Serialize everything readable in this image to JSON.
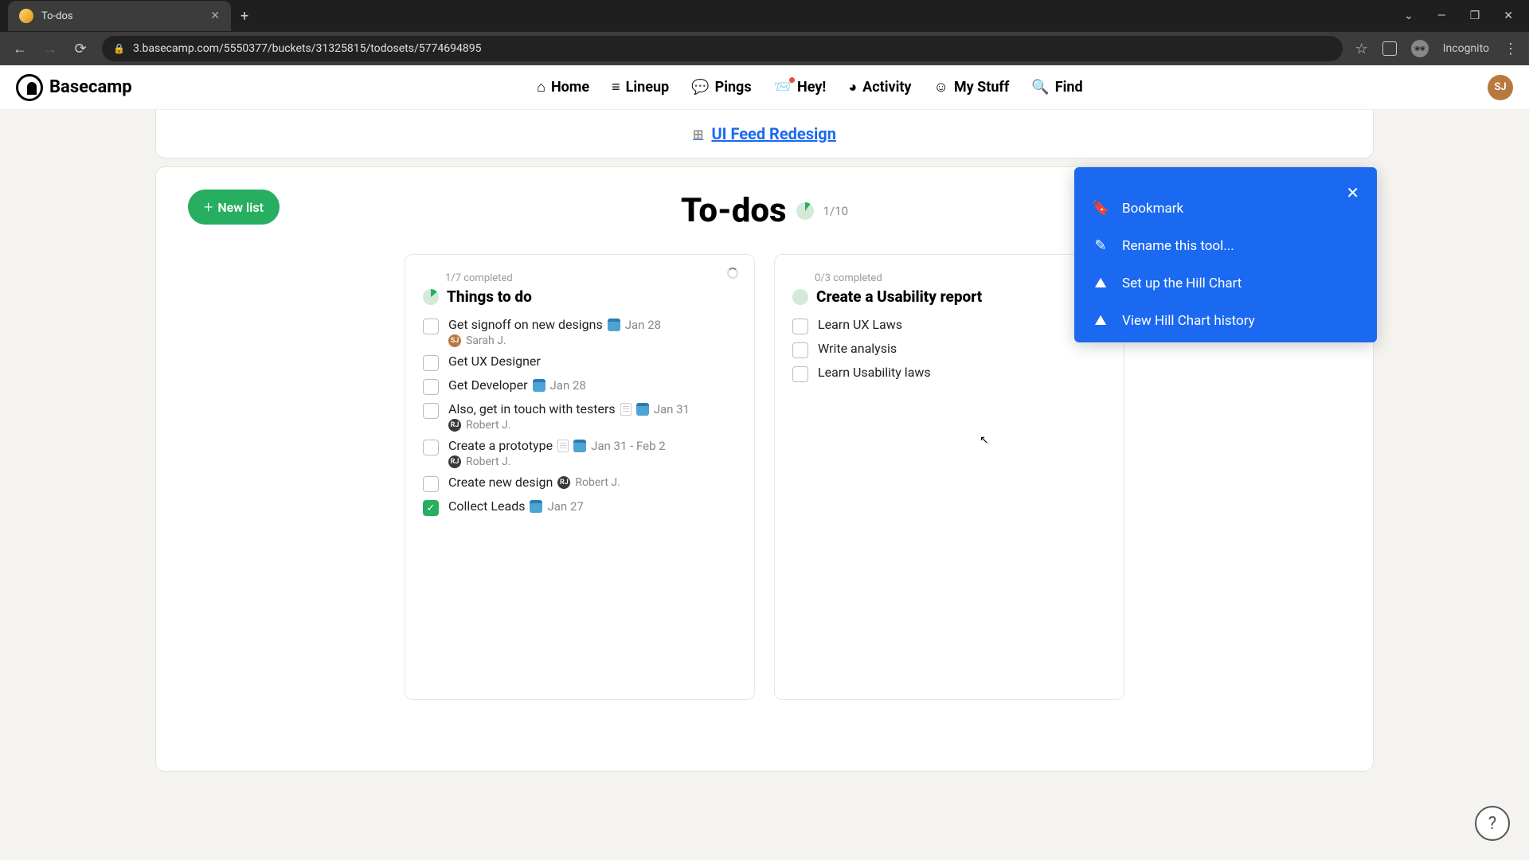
{
  "browser": {
    "tab_title": "To-dos",
    "url": "3.basecamp.com/5550377/buckets/31325815/todosets/5774694895",
    "incognito_label": "Incognito"
  },
  "nav": {
    "logo": "Basecamp",
    "items": {
      "home": "Home",
      "lineup": "Lineup",
      "pings": "Pings",
      "hey": "Hey!",
      "activity": "Activity",
      "mystuff": "My Stuff",
      "find": "Find"
    },
    "avatar_initials": "SJ"
  },
  "project": {
    "name": "UI Feed Redesign"
  },
  "page": {
    "title": "To-dos",
    "new_list_label": "New list",
    "progress": "1/10"
  },
  "lists": [
    {
      "completed_text": "1/7 completed",
      "title": "Things to do",
      "items": [
        {
          "text": "Get signoff on new designs",
          "date": "Jan 28",
          "has_cal": true,
          "assignee": "Sarah J.",
          "assignee_av": "SJ",
          "av_class": "av-sj"
        },
        {
          "text": "Get UX Designer"
        },
        {
          "text": "Get Developer",
          "date": "Jan 28",
          "has_cal": true
        },
        {
          "text": "Also, get in touch with testers",
          "date": "Jan 31",
          "has_cal": true,
          "has_note": true,
          "assignee": "Robert J.",
          "assignee_av": "RJ",
          "av_class": "av-rj"
        },
        {
          "text": "Create a prototype",
          "date": "Jan 31 - Feb 2",
          "has_cal": true,
          "has_note": true,
          "assignee": "Robert J.",
          "assignee_av": "RJ",
          "av_class": "av-rj"
        },
        {
          "text": "Create new design",
          "inline_assignee": "Robert J.",
          "inline_av": "RJ",
          "av_class": "av-rj"
        },
        {
          "text": "Collect Leads",
          "date": "Jan 27",
          "has_cal": true,
          "done": true
        }
      ]
    },
    {
      "completed_text": "0/3 completed",
      "title": "Create a Usability report",
      "empty_pie": true,
      "items": [
        {
          "text": "Learn UX Laws"
        },
        {
          "text": "Write analysis"
        },
        {
          "text": "Learn Usability laws"
        }
      ]
    }
  ],
  "dropdown": {
    "bookmark": "Bookmark",
    "rename": "Rename this tool...",
    "hillchart": "Set up the Hill Chart",
    "hillhistory": "View Hill Chart history"
  }
}
